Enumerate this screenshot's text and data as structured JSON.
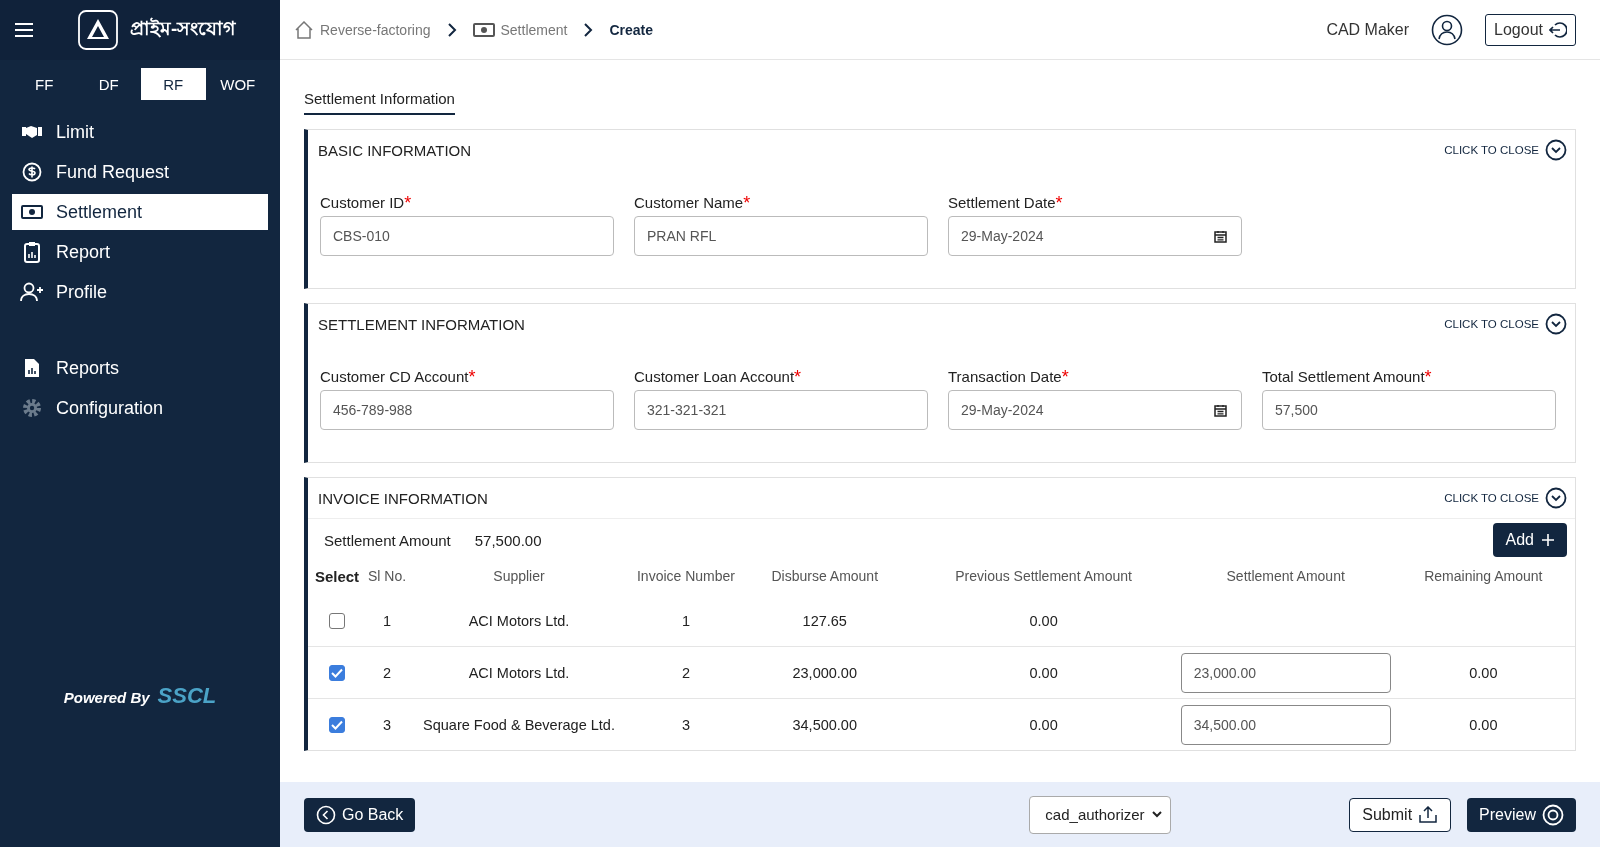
{
  "sidebar": {
    "brand": "প্রাইম-সংযোগ",
    "tabs": [
      {
        "label": "FF",
        "selected": false
      },
      {
        "label": "DF",
        "selected": false
      },
      {
        "label": "RF",
        "selected": true
      },
      {
        "label": "WOF",
        "selected": false
      }
    ],
    "items": [
      {
        "label": "Limit",
        "selected": false
      },
      {
        "label": "Fund Request",
        "selected": false
      },
      {
        "label": "Settlement",
        "selected": true
      },
      {
        "label": "Report",
        "selected": false
      },
      {
        "label": "Profile",
        "selected": false
      }
    ],
    "items_2": [
      {
        "label": "Reports",
        "selected": false
      },
      {
        "label": "Configuration",
        "selected": false
      }
    ],
    "powered_by": "Powered By",
    "powered_brand": "SSCL"
  },
  "breadcrumb": [
    {
      "label": "Reverse-factoring",
      "current": false
    },
    {
      "label": "Settlement",
      "current": false
    },
    {
      "label": "Create",
      "current": true
    }
  ],
  "user": {
    "name": "CAD Maker",
    "logout": "Logout"
  },
  "page_tab": "Settlement Information",
  "sections": [
    {
      "title": "BASIC INFORMATION",
      "action": "CLICK TO CLOSE",
      "fields": [
        {
          "label": "Customer ID",
          "mark": "*",
          "value": "CBS-010",
          "kind": "text"
        },
        {
          "label": "Customer Name",
          "mark": "*",
          "value": "PRAN RFL",
          "kind": "text"
        },
        {
          "label": "Settlement Date",
          "mark": "*",
          "value": "29-May-2024",
          "kind": "date"
        }
      ]
    },
    {
      "title": "SETTLEMENT INFORMATION",
      "action": "CLICK TO CLOSE",
      "fields": [
        {
          "label": "Customer CD Account",
          "mark": "*",
          "value": "456-789-988",
          "kind": "text"
        },
        {
          "label": "Customer Loan Account",
          "mark": "*",
          "value": "321-321-321",
          "kind": "text"
        },
        {
          "label": "Transaction Date",
          "mark": "*",
          "value": "29-May-2024",
          "kind": "date"
        },
        {
          "label": "Total Settlement Amount",
          "mark": "*",
          "value": "57,500",
          "kind": "text"
        }
      ]
    }
  ],
  "invoice": {
    "title": "INVOICE INFORMATION",
    "action": "CLICK TO CLOSE",
    "summary_label": "Settlement Amount",
    "summary_value": "57,500.00",
    "add": "Add",
    "columns": [
      "Select",
      "Sl No.",
      "Supplier",
      "Invoice Number",
      "Disburse Amount",
      "Previous Settlement Amount",
      "Settlement Amount",
      "Remaining Amount"
    ],
    "rows": [
      {
        "checked": false,
        "sl": "1",
        "supplier": "ACI Motors Ltd.",
        "invoice_number": "1",
        "disburse": "127.65",
        "previous": "0.00"
      },
      {
        "checked": true,
        "sl": "2",
        "supplier": "ACI Motors Ltd.",
        "invoice_number": "2",
        "disburse": "23,000.00",
        "previous": "0.00",
        "settlement": "23,000.00",
        "remaining": "0.00"
      },
      {
        "checked": true,
        "sl": "3",
        "supplier": "Square Food & Beverage Ltd.",
        "invoice_number": "3",
        "disburse": "34,500.00",
        "previous": "0.00",
        "settlement": "34,500.00",
        "remaining": "0.00"
      }
    ]
  },
  "footer": {
    "back": "Go Back",
    "role": "cad_authorizer",
    "submit": "Submit",
    "preview": "Preview"
  }
}
